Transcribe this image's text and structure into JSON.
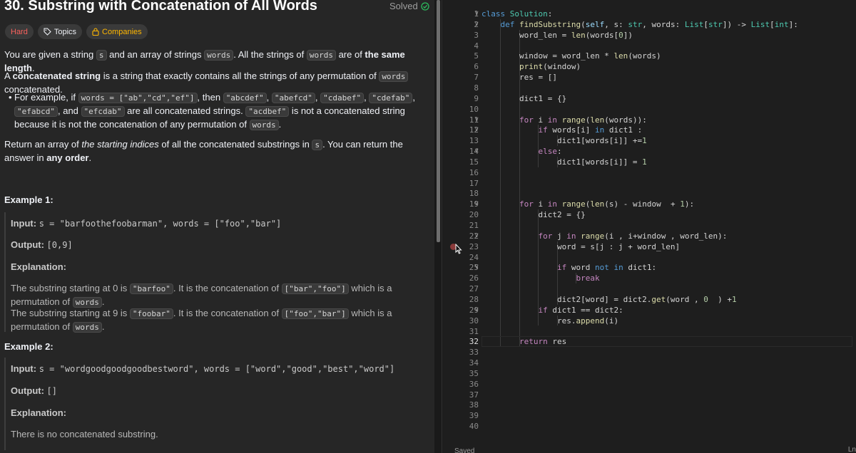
{
  "problem": {
    "title": "30. Substring with Concatenation of All Words",
    "status": "Solved",
    "tags": [
      "Hard",
      "Topics",
      "Companies"
    ],
    "p1": [
      "You are given a string ",
      "s",
      " and an array of strings ",
      "words",
      ". All the strings of ",
      "words",
      " are of ",
      "the same length",
      "."
    ],
    "p2": [
      "A ",
      "concatenated string",
      " is a string that exactly contains all the strings of any permutation of ",
      "words",
      " concatenated."
    ],
    "bullet": [
      "For example, if ",
      "words = [\"ab\",\"cd\",\"ef\"]",
      ", then ",
      "\"abcdef\"",
      ", ",
      "\"abefcd\"",
      ", ",
      "\"cdabef\"",
      ", ",
      "\"cdefab\"",
      ", ",
      "\"efabcd\"",
      ", and ",
      "\"efcdab\"",
      " are all concatenated strings. ",
      "\"acdbef\"",
      " is not a concatenated string because it is not the concatenation of any permutation of ",
      "words",
      "."
    ],
    "p3": [
      "Return an array of ",
      "the starting indices",
      " of all the concatenated substrings in ",
      "s",
      ". You can return the answer in ",
      "any order",
      "."
    ],
    "ex1": {
      "heading": "Example 1:",
      "input_label": "Input:",
      "input": "s = \"barfoothefoobarman\", words = [\"foo\",\"bar\"]",
      "output_label": "Output:",
      "output": "[0,9]",
      "expl_label": "Explanation:",
      "e1": [
        "The substring starting at 0 is ",
        "\"barfoo\"",
        ". It is the concatenation of ",
        "[\"bar\",\"foo\"]",
        " which is a permutation of ",
        "words",
        "."
      ],
      "e2": [
        "The substring starting at 9 is ",
        "\"foobar\"",
        ". It is the concatenation of ",
        "[\"foo\",\"bar\"]",
        " which is a permutation of ",
        "words",
        "."
      ]
    },
    "ex2": {
      "heading": "Example 2:",
      "input_label": "Input:",
      "input": "s = \"wordgoodgoodgoodbestword\", words = [\"word\",\"good\",\"best\",\"word\"]",
      "output_label": "Output:",
      "output": "[]",
      "expl_label": "Explanation:",
      "expl": "There is no concatenated substring."
    }
  },
  "editor": {
    "saved_label": "Saved",
    "status_right": "Ln",
    "current_line": 32,
    "lines": [
      "class Solution:",
      "    def findSubstring(self, s: str, words: List[str]) -> List[int]:",
      "        word_len = len(words[0])",
      "",
      "        window = word_len * len(words)",
      "        print(window)",
      "        res = []",
      "",
      "        dict1 = {}",
      "",
      "        for i in range(len(words)):",
      "            if words[i] in dict1 :",
      "                dict1[words[i]] +=1",
      "            else:",
      "                dict1[words[i]] = 1",
      "",
      "",
      "",
      "        for i in range(len(s) - window  + 1):",
      "            dict2 = {}",
      "",
      "            for j in range(i , i+window , word_len):",
      "                word = s[j : j + word_len]",
      "",
      "                if word not in dict1:",
      "                    break",
      "",
      "                dict2[word] = dict2.get(word , 0  ) +1",
      "            if dict1 == dict2:",
      "                res.append(i)",
      "",
      "        return res",
      "",
      "",
      "",
      "",
      "",
      "",
      "",
      ""
    ],
    "folds": [
      1,
      2,
      11,
      12,
      14,
      19,
      22,
      25,
      29
    ]
  }
}
